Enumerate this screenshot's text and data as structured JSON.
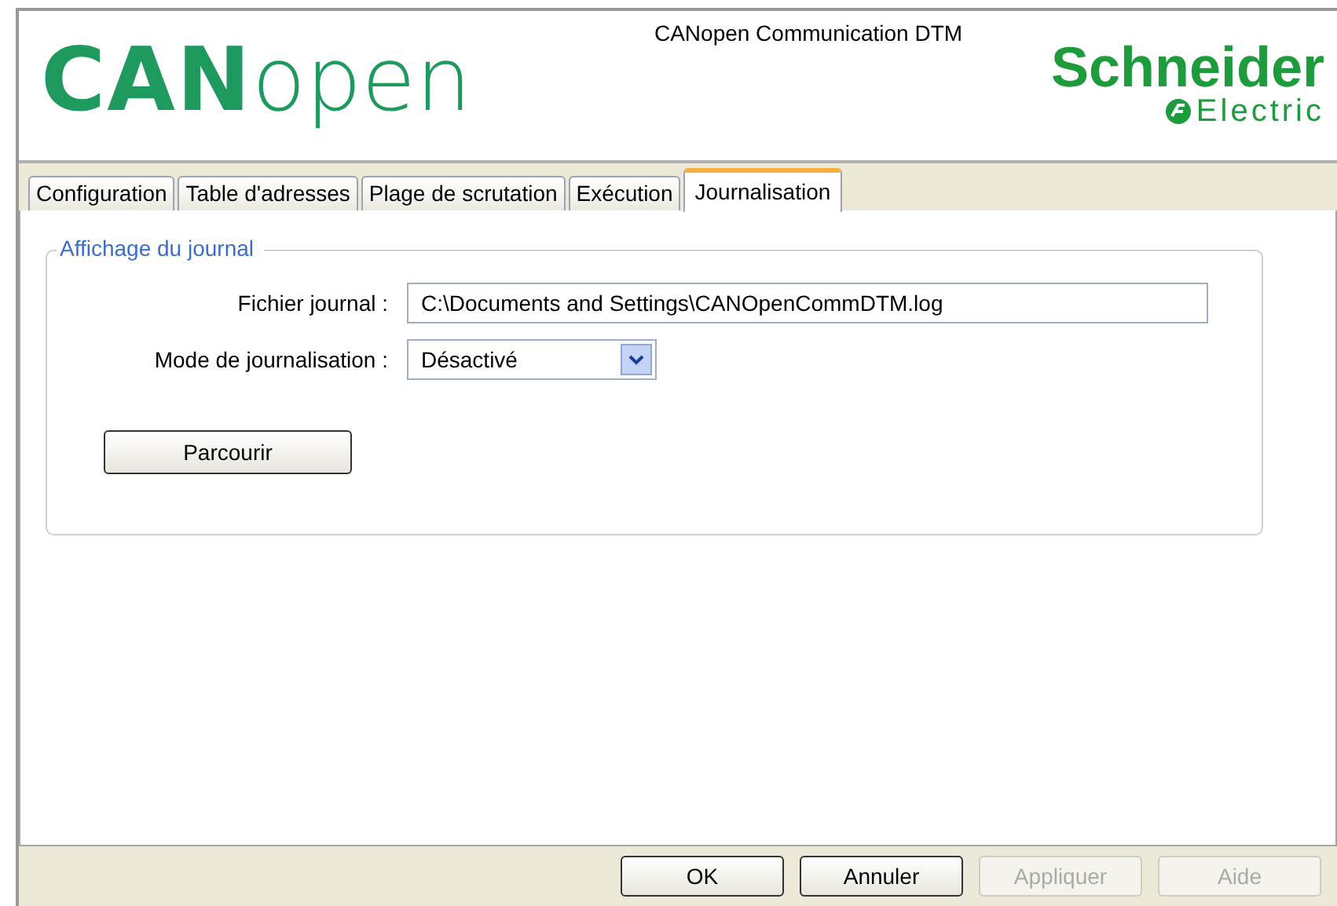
{
  "header": {
    "title": "CANopen Communication DTM",
    "logo_left": {
      "bold": "CAN",
      "light": "open"
    },
    "logo_right": {
      "name": "Schneider",
      "sub": "Electric"
    }
  },
  "tabs": [
    {
      "label": "Configuration",
      "selected": false
    },
    {
      "label": "Table d'adresses",
      "selected": false
    },
    {
      "label": "Plage de scrutation",
      "selected": false
    },
    {
      "label": "Exécution",
      "selected": false
    },
    {
      "label": "Journalisation",
      "selected": true
    }
  ],
  "group": {
    "title": "Affichage du journal",
    "fields": [
      {
        "kind": "text",
        "label": "Fichier journal :",
        "value": "C:\\Documents and Settings\\CANOpenCommDTM.log"
      },
      {
        "kind": "select",
        "label": "Mode de journalisation :",
        "value": "Désactivé"
      }
    ],
    "browse_button": "Parcourir"
  },
  "buttons": [
    {
      "label": "OK",
      "disabled": false
    },
    {
      "label": "Annuler",
      "disabled": false
    },
    {
      "label": "Appliquer",
      "disabled": true
    },
    {
      "label": "Aide",
      "disabled": true
    }
  ]
}
